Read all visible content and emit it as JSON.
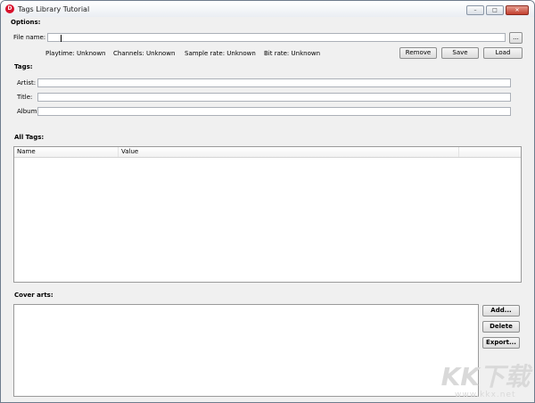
{
  "window": {
    "title": "Tags Library Tutorial",
    "app_icon": "D"
  },
  "options": {
    "group_label": "Options:",
    "file_name_label": "File name:",
    "file_name_value": "",
    "browse_label": "...",
    "playtime": "Playtime:  Unknown",
    "channels": "Channels:  Unknown",
    "sample_rate": "Sample rate:  Unknown",
    "bit_rate": "Bit rate:  Unknown",
    "remove_label": "Remove",
    "save_label": "Save",
    "load_label": "Load"
  },
  "tags": {
    "group_label": "Tags:",
    "artist_label": "Artist:",
    "artist_value": "",
    "title_label": "Title:",
    "title_value": "",
    "album_label": "Album:",
    "album_value": ""
  },
  "all_tags": {
    "group_label": "All Tags:",
    "columns": [
      "Name",
      "Value"
    ],
    "rows": []
  },
  "cover_arts": {
    "group_label": "Cover arts:",
    "add_label": "Add...",
    "delete_label": "Delete",
    "export_label": "Export..."
  },
  "watermark": {
    "logo": "KK下载",
    "url": "www.kkx.net"
  }
}
